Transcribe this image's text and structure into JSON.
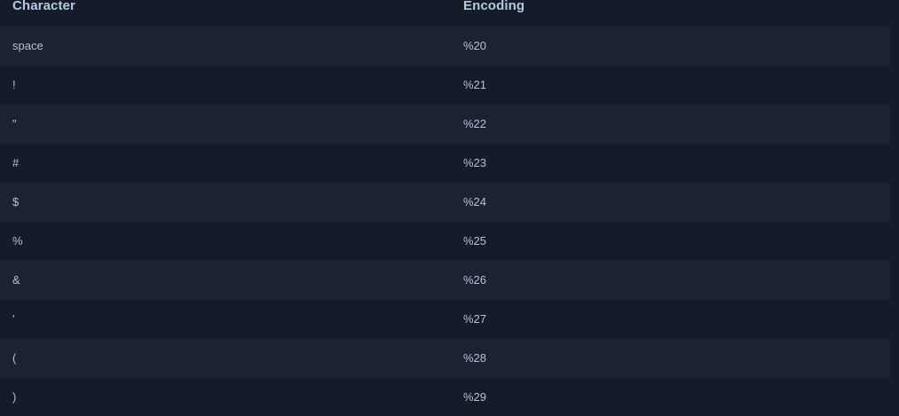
{
  "table": {
    "headers": {
      "character": "Character",
      "encoding": "Encoding"
    },
    "rows": [
      {
        "character": "space",
        "encoding": "%20"
      },
      {
        "character": "!",
        "encoding": "%21"
      },
      {
        "character": "\"",
        "encoding": "%22"
      },
      {
        "character": "#",
        "encoding": "%23"
      },
      {
        "character": "$",
        "encoding": "%24"
      },
      {
        "character": "%",
        "encoding": "%25"
      },
      {
        "character": "&",
        "encoding": "%26"
      },
      {
        "character": "'",
        "encoding": "%27"
      },
      {
        "character": "(",
        "encoding": "%28"
      },
      {
        "character": ")",
        "encoding": "%29"
      }
    ]
  },
  "colors": {
    "background": "#141c2a",
    "stripe": "#1b2333",
    "header_text": "#b8c6e0",
    "cell_text": "#b4c0d6"
  }
}
